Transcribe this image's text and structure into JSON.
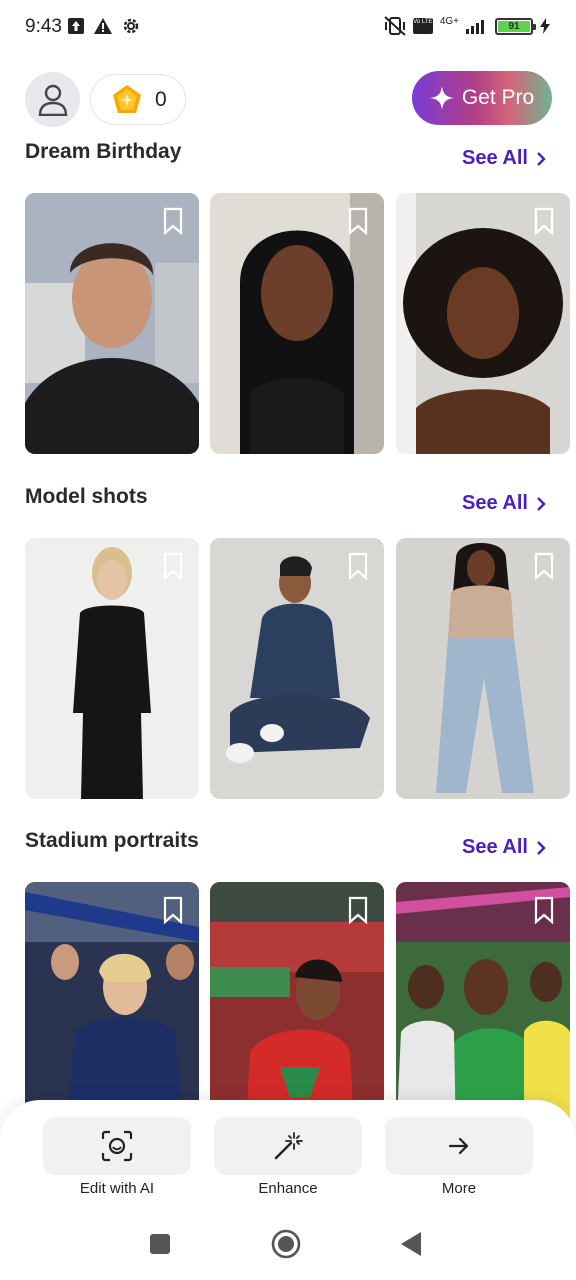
{
  "status_bar": {
    "time": "9:43",
    "network": "4G+",
    "volte": "Vo LTE",
    "battery": "91"
  },
  "header": {
    "avatar_icon": "user-icon",
    "coin_icon": "gem-coin-icon",
    "coin_count": "0",
    "pro_icon": "sparkle-icon",
    "pro_label": "Get Pro"
  },
  "sections": [
    {
      "title": "Dream Birthday",
      "see_all": "See All"
    },
    {
      "title": "Model shots",
      "see_all": "See All"
    },
    {
      "title": "Stadium portraits",
      "see_all": "See All"
    }
  ],
  "actions": [
    {
      "label": "Edit with AI",
      "icon": "ai-face-scan-icon"
    },
    {
      "label": "Enhance",
      "icon": "magic-wand-icon"
    },
    {
      "label": "More",
      "icon": "arrow-right-icon"
    }
  ],
  "colors": {
    "accent": "#4a1fc2",
    "pro_gradient": [
      "#7a3cd6",
      "#b13f86",
      "#d4667a",
      "#6fb392"
    ],
    "battery": "#63d04b"
  }
}
